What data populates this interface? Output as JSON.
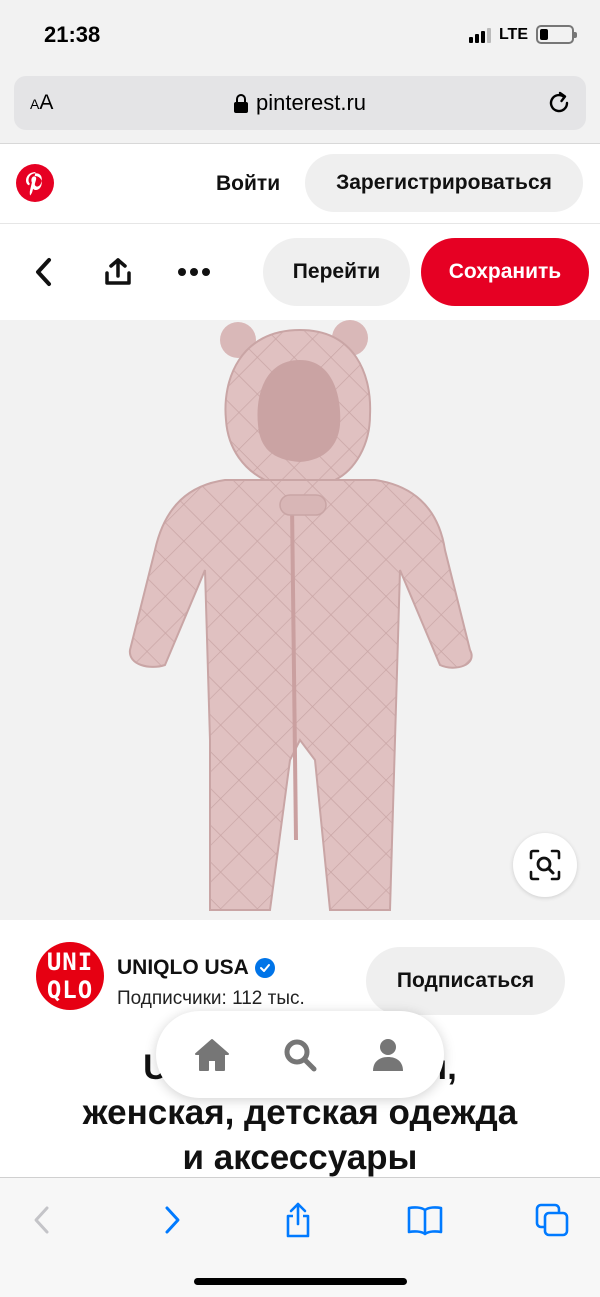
{
  "status_bar": {
    "time": "21:38",
    "network": "LTE",
    "battery_level": 0.25
  },
  "browser": {
    "text_size_label": "AA",
    "url": "pinterest.ru",
    "icons": [
      "lock-icon",
      "reload-icon"
    ]
  },
  "pinterest_header": {
    "logo": "pinterest-logo",
    "login_label": "Войти",
    "signup_label": "Зарегистрироваться"
  },
  "pin_actions": {
    "back_icon": "chevron-left-icon",
    "share_icon": "share-icon",
    "more_icon": "more-dots-icon",
    "go_label": "Перейти",
    "save_label": "Сохранить"
  },
  "image": {
    "description_icon": "visual-search-icon"
  },
  "creator": {
    "logo_lines": [
      "UNI",
      "QLO"
    ],
    "name": "UNIQLO USA",
    "verified": true,
    "followers": "Подписчики: 112 тыс.",
    "subscribe_label": "Подписаться"
  },
  "pin": {
    "title_line1": "UNIQLO: мужская,",
    "title_line2": "женская, детская одежда",
    "title_line3": "и аксессуары"
  },
  "floating_nav": {
    "items": [
      "home-icon",
      "search-icon",
      "profile-icon"
    ]
  },
  "safari_toolbar": {
    "items": [
      "back-icon",
      "forward-icon",
      "share-icon",
      "bookmarks-icon",
      "tabs-icon"
    ]
  },
  "colors": {
    "pinterest_red": "#e60023",
    "uniqlo_red": "#e60012",
    "verified_blue": "#0074e8",
    "button_gray": "#efefef",
    "link_blue": "#007aff"
  }
}
